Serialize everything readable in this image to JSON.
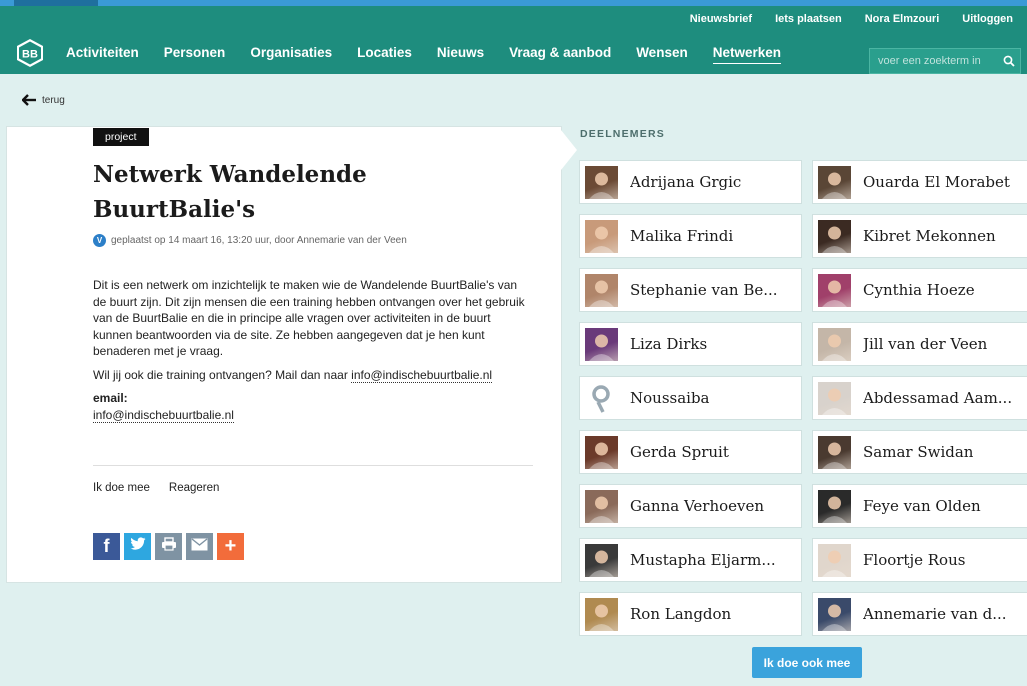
{
  "utility_nav": [
    "Nieuwsbrief",
    "Iets plaatsen",
    "Nora Elmzouri",
    "Uitloggen"
  ],
  "logo_text": "BB",
  "main_nav": [
    {
      "label": "Activiteiten"
    },
    {
      "label": "Personen"
    },
    {
      "label": "Organisaties"
    },
    {
      "label": "Locaties"
    },
    {
      "label": "Nieuws"
    },
    {
      "label": "Vraag & aanbod"
    },
    {
      "label": "Wensen"
    },
    {
      "label": "Netwerken",
      "active": true
    }
  ],
  "search": {
    "placeholder": "voer een zoekterm in"
  },
  "back_label": "terug",
  "post": {
    "tag": "project",
    "title": "Netwerk Wandelende BuurtBalie's",
    "verified_badge": "V",
    "meta": "geplaatst op 14 maart 16, 13:20 uur, door Annemarie van der Veen",
    "paragraph1": "Dit is een netwerk om inzichtelijk te maken wie de Wandelende BuurtBalie's van de buurt zijn. Dit zijn mensen die een training hebben ontvangen over het gebruik van de BuurtBalie en die in principe alle vragen over activiteiten in de buurt kunnen beantwoorden via de site. Ze hebben aangegeven dat je hen kunt benaderen met je vraag.",
    "paragraph2_prefix": "Wil jij ook die training ontvangen? Mail dan naar ",
    "paragraph2_link": "info@indischebuurtbalie.nl",
    "email_label": "email:",
    "email_value": "info@indischebuurtbalie.nl",
    "actions": [
      "Ik doe mee",
      "Reageren"
    ]
  },
  "share_buttons": [
    {
      "icon": "facebook-icon",
      "glyph": "f",
      "color": "#3b5998"
    },
    {
      "icon": "twitter-icon",
      "glyph": "",
      "color": "#2ea7e0"
    },
    {
      "icon": "print-icon",
      "glyph": "",
      "color": "#7f93a3"
    },
    {
      "icon": "mail-icon",
      "glyph": "",
      "color": "#7f93a3"
    },
    {
      "icon": "plus-icon",
      "glyph": "+",
      "color": "#f26c3b"
    }
  ],
  "participants_heading": "DEELNEMERS",
  "participants": [
    {
      "name": "Adrijana Grgic",
      "color": "#6b4a35"
    },
    {
      "name": "Ouarda El Morabet",
      "color": "#5a4636"
    },
    {
      "name": "Malika Frindi",
      "color": "#c89a7a"
    },
    {
      "name": "Kibret Mekonnen",
      "color": "#3b2a22"
    },
    {
      "name": "Stephanie van Be...",
      "color": "#b0856a"
    },
    {
      "name": "Cynthia Hoeze",
      "color": "#a0406a"
    },
    {
      "name": "Liza Dirks",
      "color": "#6a3a7a"
    },
    {
      "name": "Jill van der Veen",
      "color": "#c4b6a8"
    },
    {
      "name": "Noussaiba",
      "color": "#ffffff",
      "placeholder": true
    },
    {
      "name": "Abdessamad Aam...",
      "color": "#d8d2cc"
    },
    {
      "name": "Gerda Spruit",
      "color": "#6b3a2a"
    },
    {
      "name": "Samar Swidan",
      "color": "#4a3a30"
    },
    {
      "name": "Ganna Verhoeven",
      "color": "#8a6a5a"
    },
    {
      "name": "Feye van Olden",
      "color": "#2a2a2a"
    },
    {
      "name": "Mustapha Eljarm...",
      "color": "#3a3a3a"
    },
    {
      "name": "Floortje Rous",
      "color": "#e0d6cc"
    },
    {
      "name": "Ron Langdon",
      "color": "#b08a50"
    },
    {
      "name": "Annemarie van d...",
      "color": "#3a4a6a"
    }
  ],
  "cta_label": "Ik doe ook mee"
}
